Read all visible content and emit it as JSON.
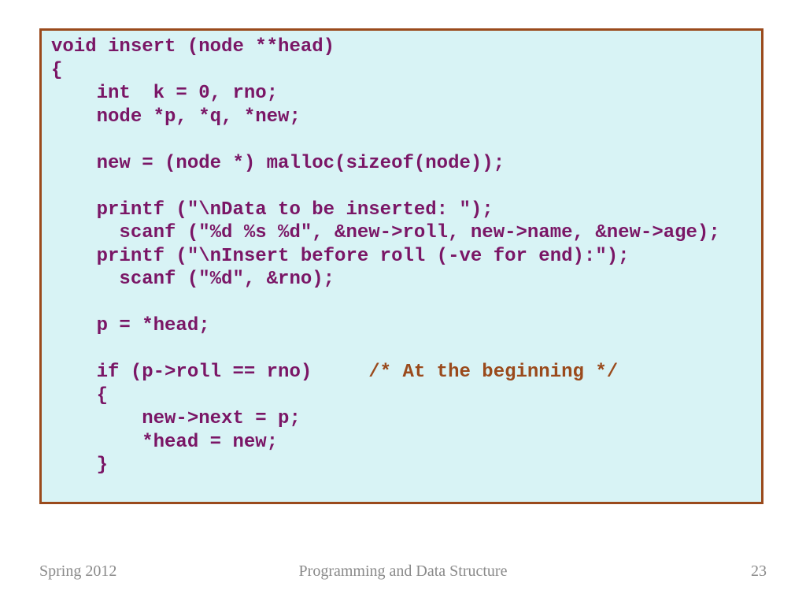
{
  "code": {
    "l1": "void insert (node **head)",
    "l2": "{",
    "l3": "    int  k = 0, rno;",
    "l4": "    node *p, *q, *new;",
    "l5": "",
    "l6": "    new = (node *) malloc(sizeof(node));",
    "l7": "",
    "l8": "    printf (\"\\nData to be inserted: \");",
    "l9": "      scanf (\"%d %s %d\", &new->roll, new->name, &new->age);",
    "l10": "    printf (\"\\nInsert before roll (-ve for end):\");",
    "l11": "      scanf (\"%d\", &rno);",
    "l12": "",
    "l13": "    p = *head;",
    "l14": "",
    "l15a": "    if (p->roll == rno)     ",
    "l15b": "/* At the beginning */",
    "l16": "    {",
    "l17": "        new->next = p;",
    "l18": "        *head = new;",
    "l19": "    }"
  },
  "footer": {
    "left": "Spring 2012",
    "center": "Programming and Data Structure",
    "right": "23"
  }
}
